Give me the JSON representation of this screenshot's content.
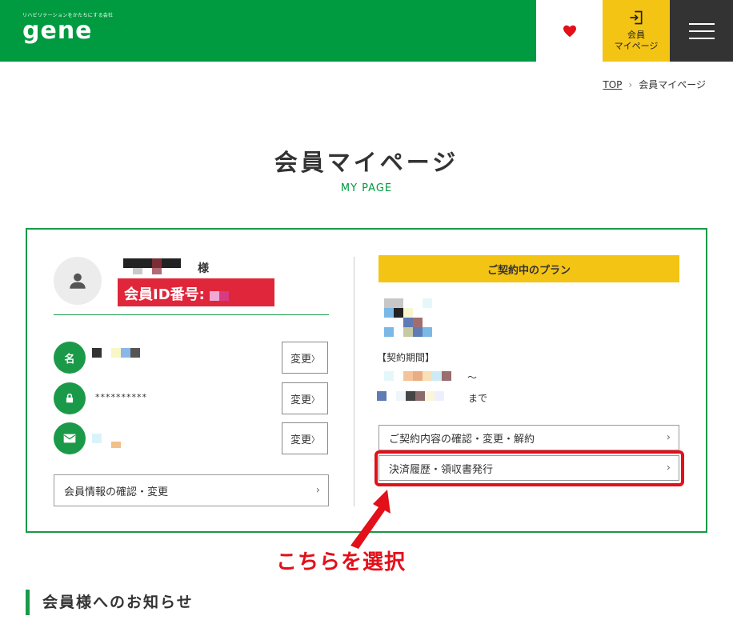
{
  "header": {
    "logo_tagline": "リハビリテーションをかたちにする会社",
    "logo_word": "gene",
    "member_button_line1": "会員",
    "member_button_line2": "マイページ",
    "colors": {
      "green": "#009a40",
      "yellow": "#f4c414",
      "dark": "#333333",
      "heart": "#e30f19"
    }
  },
  "breadcrumb": {
    "top": "TOP",
    "sep": "›",
    "current": "会員マイページ"
  },
  "page": {
    "title": "会員マイページ",
    "subtitle": "MY PAGE"
  },
  "profile": {
    "honorific": "様",
    "member_id_label": "会員ID番号:",
    "name_icon_char": "名",
    "password_value": "**********",
    "change_label": "変更",
    "change_chevron": "〉",
    "edit_info_label": "会員情報の確認・変更",
    "edit_info_chevron": "›"
  },
  "plan": {
    "header": "ご契約中のプラン",
    "period_label": "【契約期間】",
    "from_suffix": "～",
    "until_suffix": "まで",
    "actions": [
      {
        "label": "ご契約内容の確認・変更・解約",
        "chevron": "›"
      },
      {
        "label": "決済履歴・領収書発行",
        "chevron": "›"
      }
    ]
  },
  "annotation": {
    "callout": "こちらを選択"
  },
  "notice": {
    "title": "会員様へのお知らせ"
  }
}
